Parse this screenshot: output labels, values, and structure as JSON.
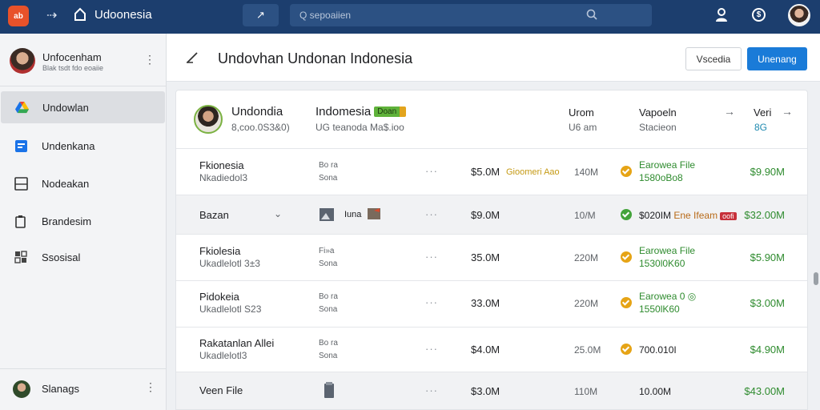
{
  "topbar": {
    "logo_text": "ab",
    "title": "Udoonesia",
    "search_placeholder": "Q sepoaiien",
    "accent": "#1c3e6e"
  },
  "sidebar": {
    "profile": {
      "name": "Unfocenham",
      "sub": "Blak tsdt fdo eoaiie"
    },
    "items": [
      {
        "label": "Undowlan",
        "icon": "google-drive-icon",
        "active": true
      },
      {
        "label": "Undenkana",
        "icon": "document-icon",
        "active": false
      },
      {
        "label": "Nodeakan",
        "icon": "image-icon",
        "active": false
      },
      {
        "label": "Brandesim",
        "icon": "clipboard-icon",
        "active": false
      },
      {
        "label": "Ssosisal",
        "icon": "grid-icon",
        "active": false
      }
    ],
    "footer": {
      "label": "Slanags"
    }
  },
  "header": {
    "title": "Undovhan Undonan Indonesia",
    "secondary_button": "Vscedia",
    "primary_button": "Unenang"
  },
  "card_header": {
    "name": "Undondia",
    "sub": "8,coo.0S3&0)",
    "col2": "Indomesia",
    "badge": "Doan",
    "col2_sub": "UG teanoda Ma$.ioo",
    "col3": "Urom",
    "col3_sub": "U6 am",
    "col4": "Vapoeln",
    "col4_sub": "Stacieon",
    "col5": "Veri",
    "col5_sub": "8G"
  },
  "rows": [
    {
      "title": "Fkionesia",
      "sub": "Nkadiedol3",
      "icon_top": "Bo ra",
      "icon_sub": "Sona",
      "amount": "$5.0M",
      "tag": "Gioomeri Aao",
      "qty": "140M",
      "status": "warn",
      "stat1": "Earowea File",
      "stat2": "1580oBo8",
      "total": "$9.90M",
      "highlight": false
    },
    {
      "title": "Bazan",
      "sub": "",
      "icon_top": "Iuna",
      "icon_sub": "",
      "amount": "$9.0M",
      "tag": "",
      "qty": "10/M",
      "status": "ok",
      "stat1": "$020IM",
      "stat_note": "Ene Ifeam",
      "red_tag": "oofi",
      "stat2": "",
      "total": "$32.00M",
      "highlight": true
    },
    {
      "title": "Fkiolesia",
      "sub": "Ukadlelotl 3±3",
      "icon_top": "Fi»a",
      "icon_sub": "Sona",
      "amount": "35.0M",
      "tag": "",
      "qty": "220M",
      "status": "warn",
      "stat1": "Earowea File",
      "stat2": "1530l0K60",
      "total": "$5.90M",
      "highlight": false
    },
    {
      "title": "Pidokeia",
      "sub": "Ukadlelotl S23",
      "icon_top": "Bo ra",
      "icon_sub": "Sona",
      "amount": "33.0M",
      "tag": "",
      "qty": "220M",
      "status": "warn",
      "stat1": "Earowea 0 ◎",
      "stat2": "1550lK60",
      "total": "$3.00M",
      "highlight": false
    },
    {
      "title": "Rakatanlan Allei",
      "sub": "Ukadlelotl3",
      "icon_top": "Bo ra",
      "icon_sub": "Sona",
      "amount": "$4.0M",
      "tag": "",
      "qty": "25.0M",
      "status": "warn",
      "stat1": "700.010I",
      "stat2": "",
      "total": "$4.90M",
      "highlight": false
    },
    {
      "title": "Veen File",
      "sub": "",
      "icon_top": "",
      "icon_sub": "",
      "amount": "$3.0M",
      "tag": "",
      "qty": "110M",
      "status": "none",
      "stat1": "10.00M",
      "stat2": "",
      "total": "$43.00M",
      "highlight": true
    }
  ]
}
